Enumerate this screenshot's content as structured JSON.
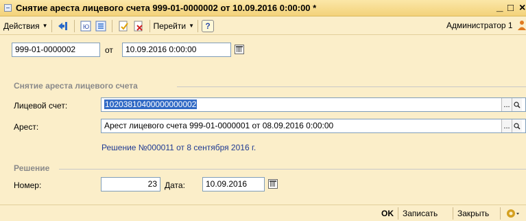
{
  "window": {
    "title": "Снятие ареста лицевого счета 999-01-0000002 от 10.09.2016 0:00:00 *",
    "min": "_",
    "max": "□",
    "close": "×"
  },
  "toolbar": {
    "actions_label": "Действия",
    "goto_label": "Перейти",
    "help_label": "?",
    "user": "Администратор 1"
  },
  "header": {
    "number": "999-01-0000002",
    "from_label": "от",
    "date": "10.09.2016  0:00:00"
  },
  "group_main": {
    "title": "Снятие ареста лицевого счета",
    "account_label": "Лицевой счет:",
    "account_value": "10203810400000000002",
    "arrest_label": "Арест:",
    "arrest_value": "Арест лицевого счета 999-01-0000001 от 08.09.2016 0:00:00",
    "decision_link": "Решение №000011 от 8 сентября 2016 г.",
    "ellipsis": "...",
    "search": "🔍"
  },
  "group_decision": {
    "title": "Решение",
    "number_label": "Номер:",
    "number_value": "23",
    "date_label": "Дата:",
    "date_value": "10.09.2016"
  },
  "footer": {
    "ok": "OK",
    "save": "Записать",
    "close": "Закрыть"
  }
}
